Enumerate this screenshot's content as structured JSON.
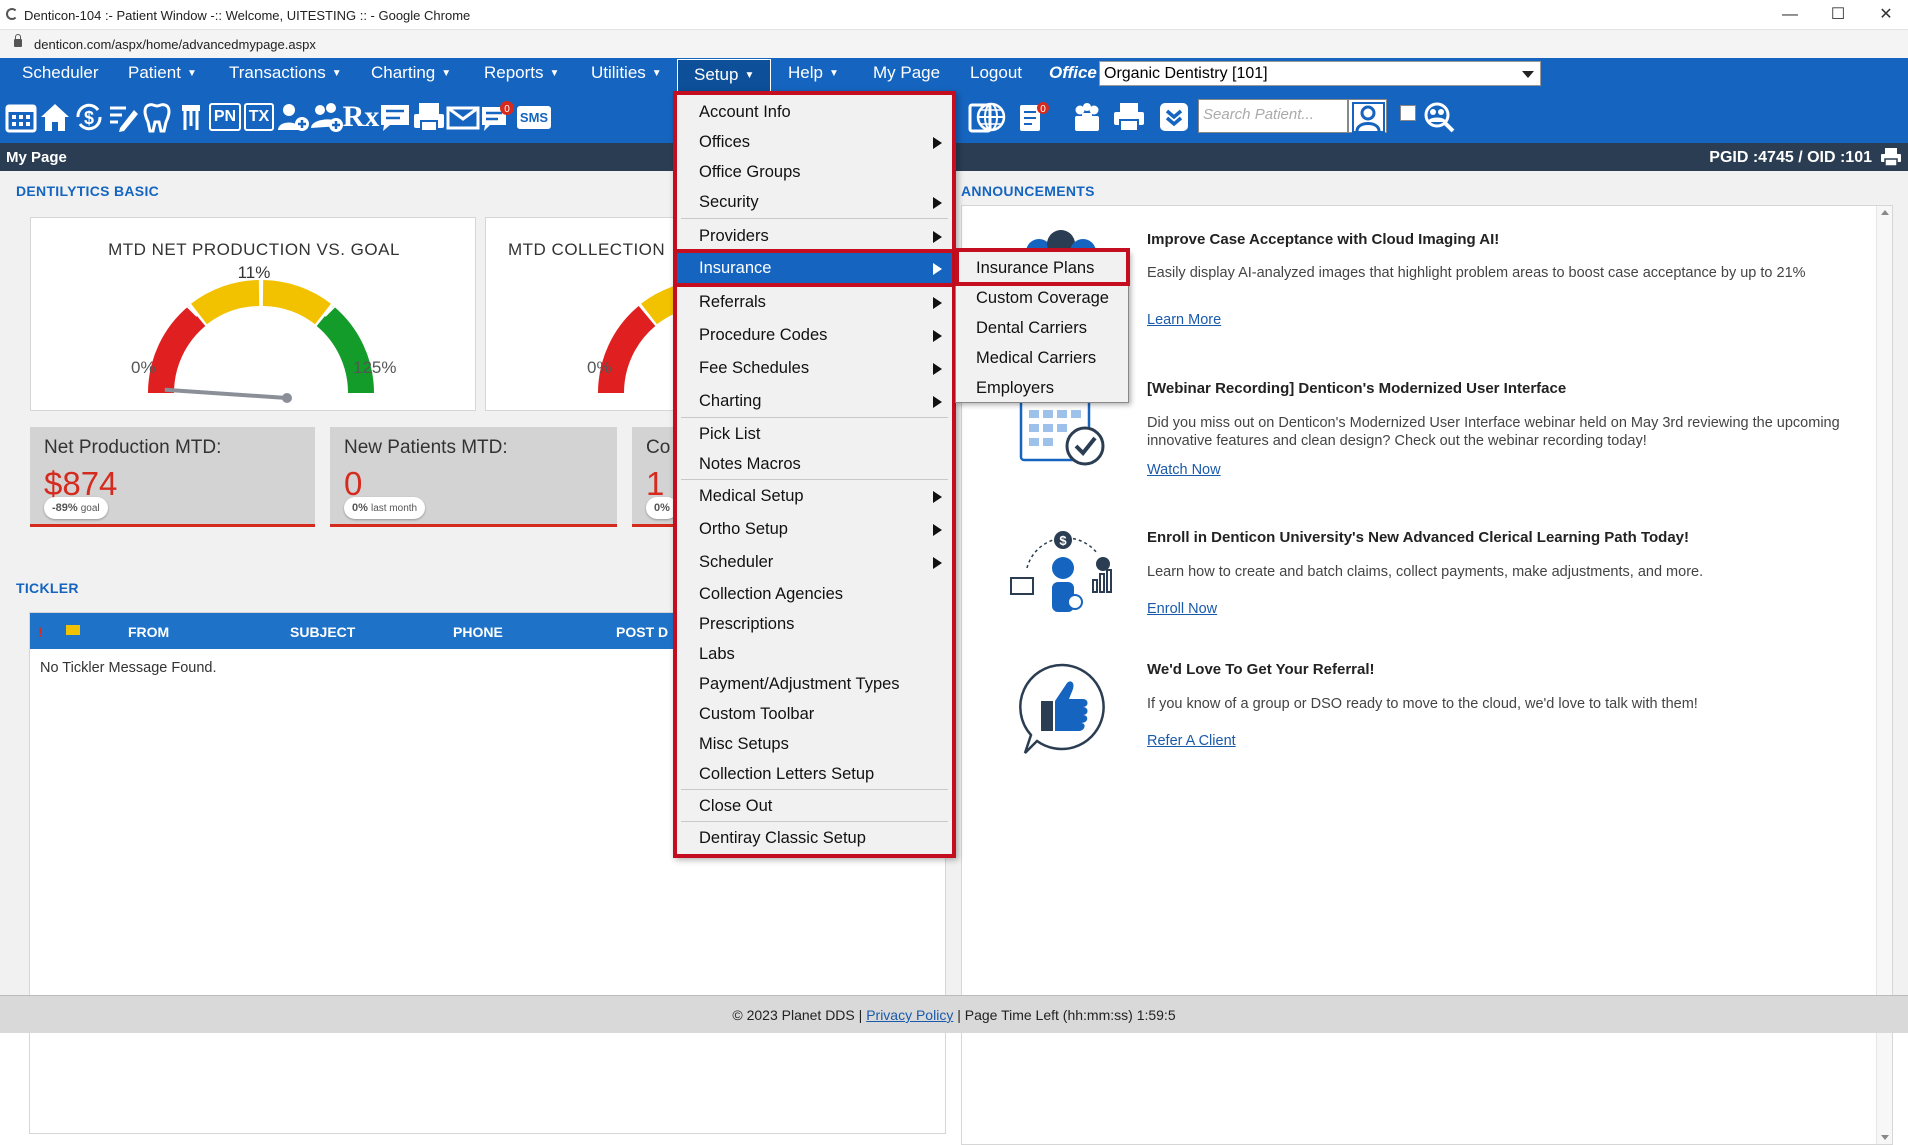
{
  "browser": {
    "title": "Denticon-104 :- Patient Window -:: Welcome, UITESTING :: - Google Chrome",
    "url": "denticon.com/aspx/home/advancedmypage.aspx",
    "minimize": "—",
    "maximize": "☐",
    "close": "✕"
  },
  "nav": {
    "scheduler": "Scheduler",
    "patient": "Patient",
    "transactions": "Transactions",
    "charting": "Charting",
    "reports": "Reports",
    "utilities": "Utilities",
    "setup": "Setup",
    "help": "Help",
    "mypage": "My Page",
    "logout": "Logout",
    "caret": "▼",
    "office_label": "Office",
    "office_value": "Organic Dentistry [101]"
  },
  "toolbar": {
    "pn": "PN",
    "tx": "TX",
    "rx": "Rx",
    "sms": "SMS",
    "badge_count": "0",
    "search_placeholder": "Search Patient..."
  },
  "pagebar": {
    "title": "My Page",
    "ids": "PGID :4745  /  OID :101"
  },
  "dentilytics": {
    "section_title": "DENTILYTICS BASIC",
    "gauge1": {
      "title": "MTD NET PRODUCTION VS. GOAL",
      "pct": "11%",
      "min": "0%",
      "max": "125%",
      "value_fraction": 0.088
    },
    "gauge2": {
      "title": "MTD COLLECTION",
      "min": "0%"
    },
    "cards": [
      {
        "label": "Net Production MTD:",
        "value": "$874",
        "pill_main": "-89%",
        "pill_sub": "goal"
      },
      {
        "label": "New Patients MTD:",
        "value": "0",
        "pill_main": "0%",
        "pill_sub": "last month"
      },
      {
        "label": "Co",
        "value": "1",
        "pill_main": "0%"
      }
    ]
  },
  "tickler": {
    "section_title": "TICKLER",
    "excl": "!",
    "columns": [
      "FROM",
      "SUBJECT",
      "PHONE",
      "POST D"
    ],
    "empty": "No Tickler Message Found."
  },
  "announcements": {
    "section_title": "ANNOUNCEMENTS",
    "items": [
      {
        "title": "Improve Case Acceptance with Cloud Imaging AI!",
        "body": "Easily display AI-analyzed images that highlight problem areas to boost case acceptance by up to 21%",
        "link": "Learn More"
      },
      {
        "title": "[Webinar Recording] Denticon's Modernized User Interface",
        "body": "Did you miss out on Denticon's Modernized User Interface webinar held on May 3rd reviewing the upcoming innovative features and clean design? Check out the webinar recording today!",
        "link": "Watch Now"
      },
      {
        "title": "Enroll in Denticon University's New Advanced Clerical Learning Path Today!",
        "body": "Learn how to create and batch claims, collect payments, make adjustments, and more.",
        "link": "Enroll Now"
      },
      {
        "title": "We'd Love To Get Your Referral!",
        "body": "If you know of a group or DSO ready to move to the cloud, we'd love to talk with them!",
        "link": "Refer A Client"
      }
    ],
    "dollar_sign": "$"
  },
  "setup_menu": {
    "items": [
      "Account Info",
      "Offices",
      "Office Groups",
      "Security",
      "Providers",
      "Insurance",
      "Referrals",
      "Procedure Codes",
      "Fee Schedules",
      "Charting",
      "Pick List",
      "Notes Macros",
      "Medical Setup",
      "Ortho Setup",
      "Scheduler",
      "Collection Agencies",
      "Prescriptions",
      "Labs",
      "Payment/Adjustment Types",
      "Custom Toolbar",
      "Misc Setups",
      "Collection Letters Setup",
      "Close Out",
      "Dentiray Classic Setup"
    ]
  },
  "insurance_submenu": {
    "items": [
      "Insurance Plans",
      "Custom Coverage",
      "Dental Carriers",
      "Medical Carriers",
      "Employers"
    ]
  },
  "footer": {
    "copyright": "© 2023 Planet DDS | ",
    "privacy": "Privacy Policy",
    "timer": " |  Page Time Left (hh:mm:ss) 1:59:5"
  },
  "colors": {
    "nav_blue": "#1565c0",
    "highlight_red": "#c40d1e",
    "stat_red": "#d52b1e"
  }
}
